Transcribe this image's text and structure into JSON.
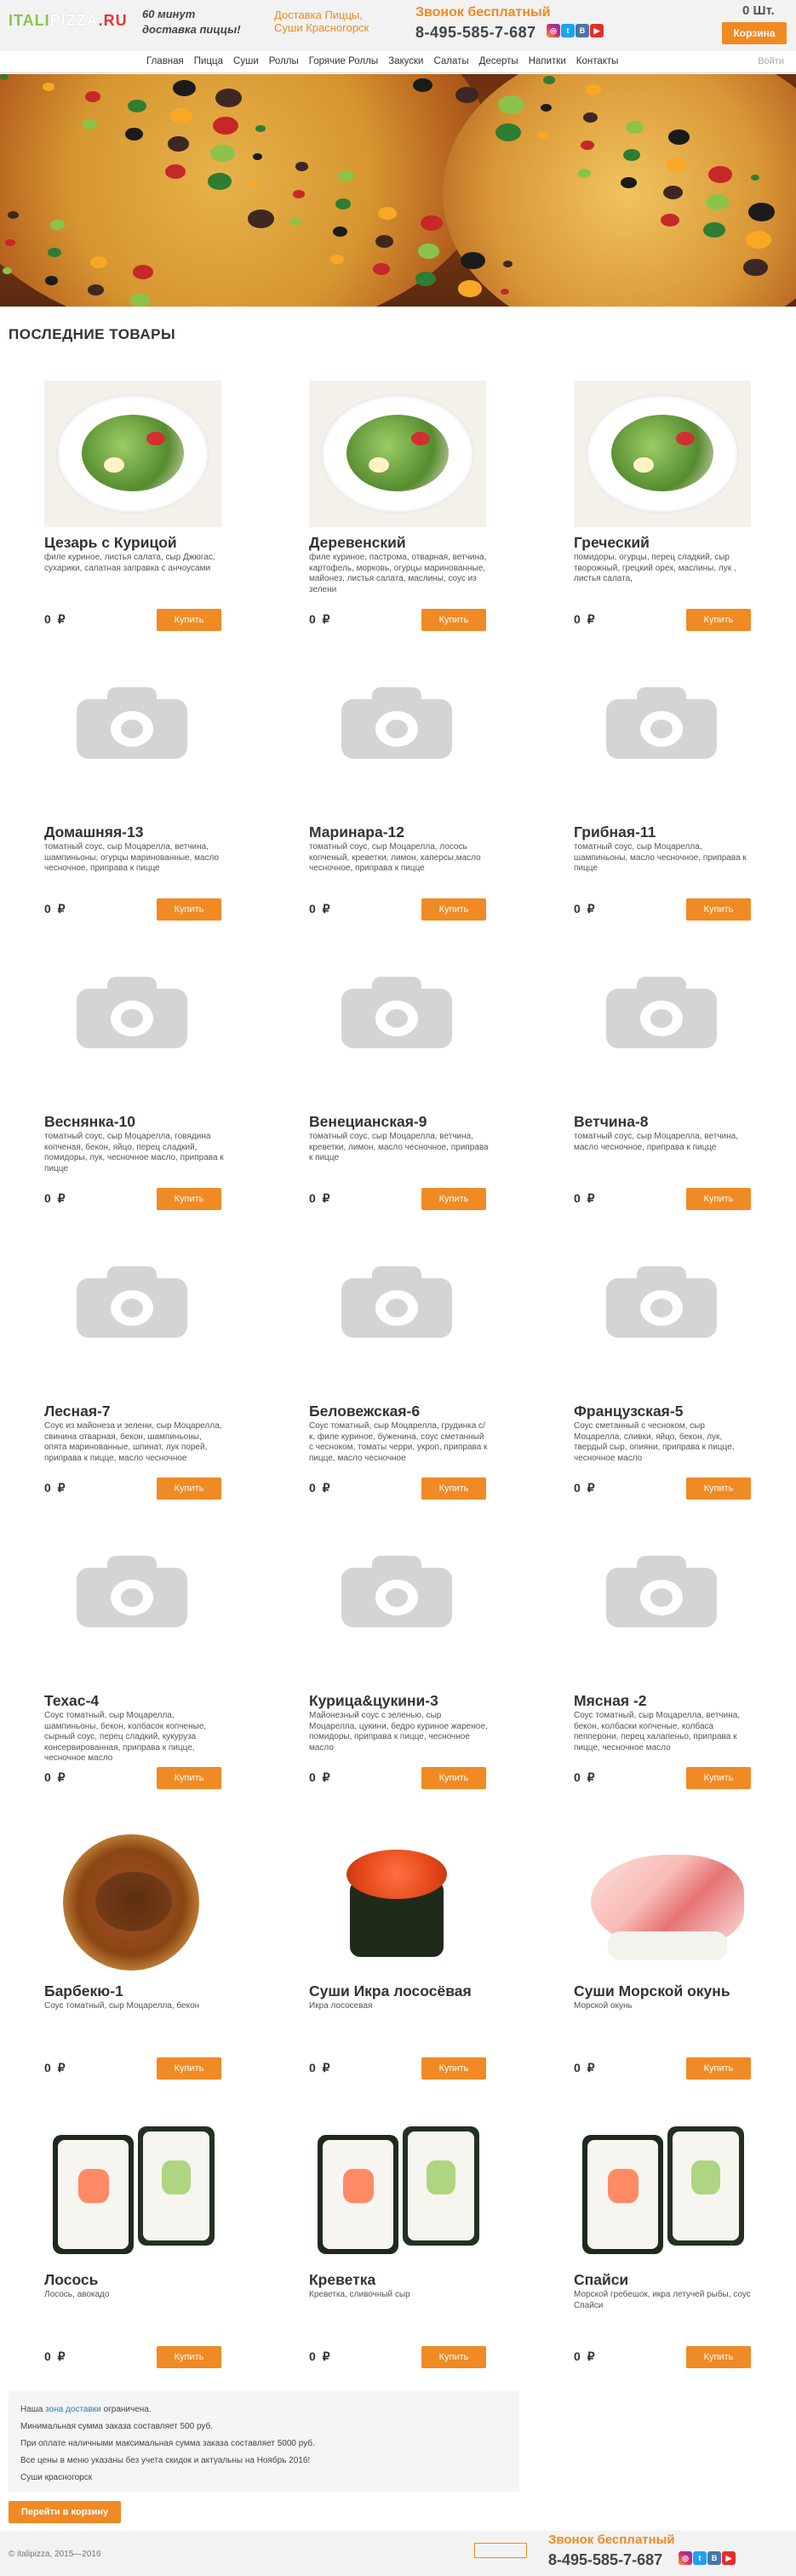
{
  "header": {
    "logo": {
      "part1": "ITALI",
      "part2": "PIZZA",
      "part3": ".RU"
    },
    "tagline_1": "60 минут",
    "tagline_2": "доставка пиццы!",
    "delivery_1": "Доставка Пиццы,",
    "delivery_2": "Суши Красногорск",
    "call_free": "Звонок бесплатный",
    "phone": "8-495-585-7-687",
    "social": [
      "instagram-icon",
      "twitter-icon",
      "vk-icon",
      "youtube-icon"
    ],
    "cart_qty": "0 Шт.",
    "cart_button": "Корзина"
  },
  "nav": {
    "items": [
      "Главная",
      "Пицца",
      "Суши",
      "Роллы",
      "Горячие Роллы",
      "Закуски",
      "Салаты",
      "Десерты",
      "Напитки",
      "Контакты"
    ],
    "login": "Войти"
  },
  "section_title": "ПОСЛЕДНИЕ ТОВАРЫ",
  "buy_label": "Купить",
  "products": [
    {
      "name": "Цезарь с Курицой",
      "desc": "филе куриное, листья салата, сыр Джюгас, сухарики, салатная заправка с анчоусами",
      "price": "0 ₽",
      "image": "salad"
    },
    {
      "name": "Деревенский",
      "desc": "филе куриное, пастрома, отварная, ветчина, картофель, морковь, огурцы маринованные, майонез, листья салата, маслины, соус из зелени",
      "price": "0 ₽",
      "image": "salad"
    },
    {
      "name": "Греческий",
      "desc": "помидоры, огурцы, перец сладкий, сыр творожный, грецкий орех, маслины, лук , листья салата,",
      "price": "0 ₽",
      "image": "salad"
    },
    {
      "name": "Домашняя-13",
      "desc": "томатный соус, сыр Моцарелла, ветчина, шампиньоны, огурцы маринованные, масло чесночное, приправа к пицце",
      "price": "0 ₽",
      "image": "none"
    },
    {
      "name": "Маринара-12",
      "desc": "томатный соус, сыр Моцарелла, лосось копченый, креветки, лимон, каперсы,масло чесночное, приправа к пицце",
      "price": "0 ₽",
      "image": "none"
    },
    {
      "name": "Грибная-11",
      "desc": "томатный соус, сыр Моцарелла, шампиньоны, масло чесночное, приправа к пицце",
      "price": "0 ₽",
      "image": "none"
    },
    {
      "name": "Веснянка-10",
      "desc": "томатный соус, сыр Моцарелла, говядина копченая, бекон, яйцо, перец сладкий, помидоры, лук, чесночное масло, приправа к пицце",
      "price": "0 ₽",
      "image": "none"
    },
    {
      "name": "Венецианская-9",
      "desc": "томатный соус, сыр Моцарелла, ветчина, креветки, лимон, масло чесночное, приправа к пицце",
      "price": "0 ₽",
      "image": "none"
    },
    {
      "name": "Ветчина-8",
      "desc": "томатный соус, сыр Моцарелла, ветчина, масло чесночное, приправа к пицце",
      "price": "0 ₽",
      "image": "none"
    },
    {
      "name": "Лесная-7",
      "desc": "Соус из майонеза и зелени, сыр Моцарелла, свинина отварная, бекон, шампиньоны, опята маринованные, шпинат, лук порей, приправа к пицце, масло чесночное",
      "price": "0 ₽",
      "image": "none"
    },
    {
      "name": "Беловежская-6",
      "desc": "Соус томатный, сыр Моцарелла, грудинка с/к, филе куриное, буженина, соус сметанный с чесноком, томаты черри, укроп, приправа к пицце, масло чесночное",
      "price": "0 ₽",
      "image": "none"
    },
    {
      "name": "Французская-5",
      "desc": "Соус сметанный с чесноком, сыр Моцарелла, сливки, яйцо, бекон, лук, твердый сыр, опияни, приправа к пицце, чесночное масло",
      "price": "0 ₽",
      "image": "none"
    },
    {
      "name": "Техас-4",
      "desc": "Соус томатный, сыр Моцарелла, шампиньоны, бекон, колбасок копченые, сырный соус, перец сладкий, кукуруза консервированная, приправа к пицце, чесночное масло",
      "price": "0 ₽",
      "image": "none"
    },
    {
      "name": "Курица&цукини-3",
      "desc": "Майонезный соус с зеленью, сыр Моцарелла, цукини, бедро куриное жареное, помидоры, приправа к пицце, чесночное масло",
      "price": "0 ₽",
      "image": "none"
    },
    {
      "name": "Мясная -2",
      "desc": "Соус томатный, сыр Моцарелла, ветчина, бекон, колбаски копченые, колбаса пепперони, перец халапеньо, приправа к пицце, чесночное масло",
      "price": "0 ₽",
      "image": "none"
    },
    {
      "name": "Барбекю-1",
      "desc": "Соус томатный, сыр Моцарелла, бекон",
      "price": "0 ₽",
      "image": "pizza"
    },
    {
      "name": "Суши Икра лососёвая",
      "desc": "Икра лососевая",
      "price": "0 ₽",
      "image": "caviar"
    },
    {
      "name": "Суши Морской окунь",
      "desc": "Морской окунь",
      "price": "0 ₽",
      "image": "nigiri"
    },
    {
      "name": "Лосось",
      "desc": "Лосось, авокадо",
      "price": "0 ₽",
      "image": "roll"
    },
    {
      "name": "Креветка",
      "desc": "Креветка, сливочный сыр",
      "price": "0 ₽",
      "image": "roll"
    },
    {
      "name": "Спайси",
      "desc": "Морской гребешок, икра летучей рыбы, соус Спайси",
      "price": "0 ₽",
      "image": "roll"
    }
  ],
  "info": {
    "zone_prefix": "Наша",
    "zone_link": "зона доставки",
    "zone_suffix": "ограничена.",
    "line2": "Минимальная сумма заказа составляет 500 руб.",
    "line3": "При оплате наличными максимальная сумма заказа составляет 5000 руб.",
    "line4": "Все цены в меню указаны без учета скидок и актуальны на Ноябрь 2016!",
    "line5": "Суши красногорск"
  },
  "to_cart_button": "Перейти в корзину",
  "footer": {
    "copyright": "© italipizza, 2015—2016",
    "call_free": "Звонок бесплатный",
    "phone": "8-495-585-7-687"
  },
  "colors": {
    "accent": "#f08a24",
    "logo_green": "#8bc34a",
    "logo_red": "#e53935"
  }
}
